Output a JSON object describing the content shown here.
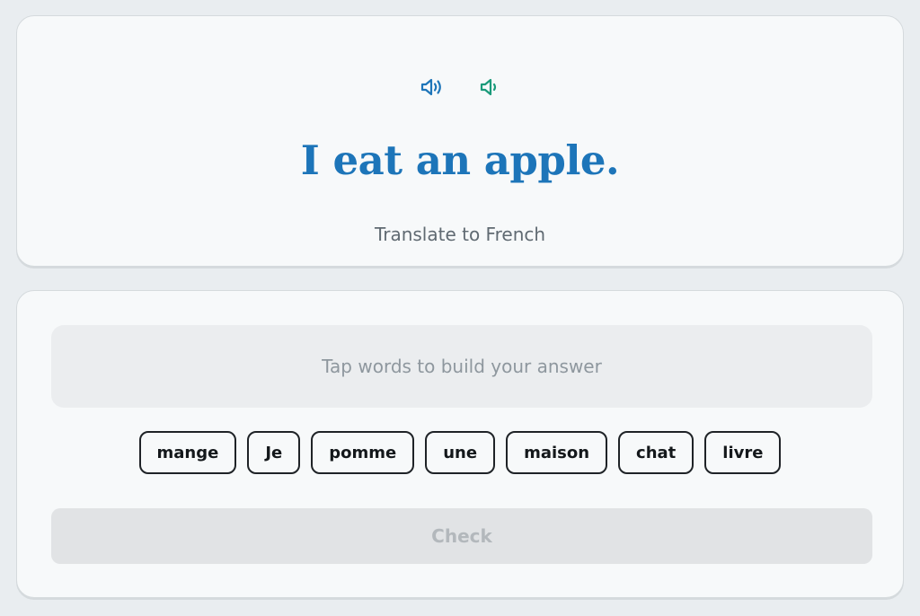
{
  "prompt": {
    "icons": {
      "normal_speed": "speaker-loud-icon",
      "slow_speed": "speaker-soft-icon"
    },
    "sentence": "I eat an apple.",
    "instruction": "Translate to French"
  },
  "answer": {
    "placeholder": "Tap words to build your answer",
    "word_bank": [
      "mange",
      "Je",
      "pomme",
      "une",
      "maison",
      "chat",
      "livre"
    ],
    "check_label": "Check"
  },
  "colors": {
    "background": "#e9edf0",
    "card": "#f7f9fa",
    "sentence": "#1d75b9",
    "speaker_normal": "#1d75b9",
    "speaker_slow": "#1a9a7a",
    "check_disabled_bg": "#e1e3e5",
    "check_disabled_text": "#b3b8bc"
  }
}
